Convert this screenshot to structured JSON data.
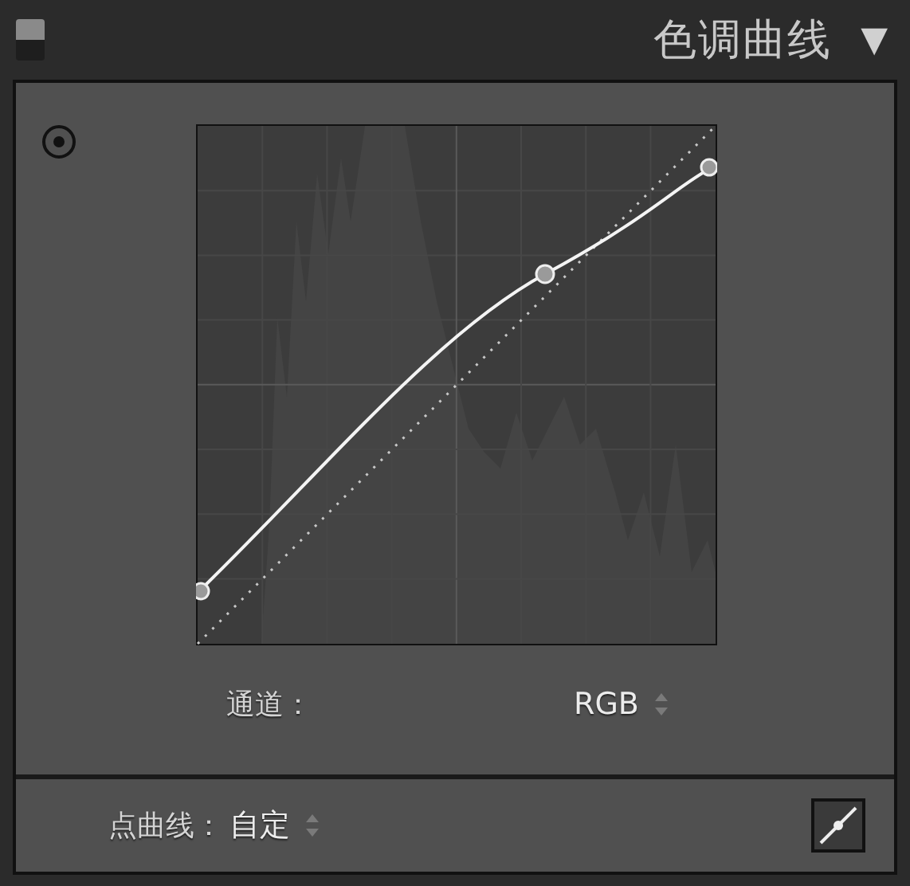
{
  "header": {
    "title": "色调曲线",
    "collapse_glyph": "▼"
  },
  "channel": {
    "label": "通道：",
    "value": "RGB"
  },
  "point_curve": {
    "label": "点曲线：",
    "value": "自定"
  }
}
